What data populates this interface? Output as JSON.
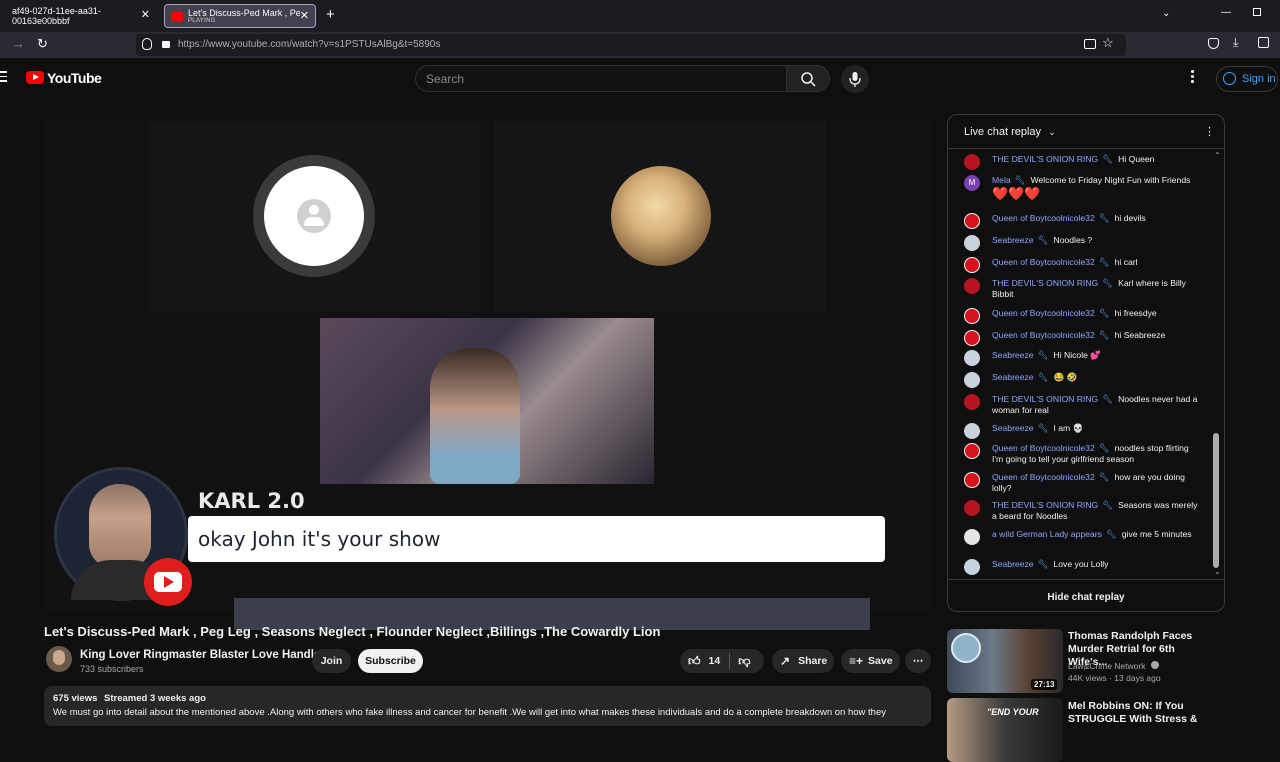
{
  "browser": {
    "tabs": [
      {
        "title": "af49-027d-11ee-aa31-00163e00bbbf"
      },
      {
        "title": "Let's Discuss-Ped Mark , Peg Le",
        "status": "PLAYING"
      }
    ],
    "url": "https://www.youtube.com/watch?v=s1PSTUsAlBg&t=5890s"
  },
  "header": {
    "logo": "YouTube",
    "search_placeholder": "Search",
    "signin": "Sign in"
  },
  "player": {
    "caption_name": "KARL 2.0",
    "caption_text": "okay John it's your show"
  },
  "video": {
    "title": "Let's Discuss-Ped Mark , Peg Leg , Seasons Neglect , Flounder Neglect ,Billings ,The Cowardly Lion",
    "channel": "King Lover Ringmaster Blaster Love Handle",
    "subscribers": "733 subscribers",
    "join": "Join",
    "subscribe": "Subscribe",
    "likes": "14",
    "share": "Share",
    "save": "Save",
    "views": "675 views",
    "streamed": "Streamed 3 weeks ago",
    "description": "We must go into detail about the mentioned above .Along with others who fake illness and cancer for benefit .We will get into what makes these individuals and do a complete breakdown on how they"
  },
  "chat": {
    "header": "Live chat replay",
    "footer": "Hide chat replay",
    "messages": [
      {
        "author": "THE DEVIL'S ONION RING",
        "text": "Hi Queen",
        "avatar": "devil"
      },
      {
        "author": "Mela",
        "text": "Welcome to Friday Night Fun with Friends",
        "extra": "❤️❤️❤️",
        "avatar": "m"
      },
      {
        "author": "Queen of Boytcoolnicole32",
        "text": "hi devils",
        "avatar": "stop"
      },
      {
        "author": "Seabreeze",
        "text": "Noodles ?",
        "avatar": "plain"
      },
      {
        "author": "Queen of Boytcoolnicole32",
        "text": "hi carl",
        "avatar": "stop"
      },
      {
        "author": "THE DEVIL'S ONION RING",
        "text": "Karl where is Billy Bibbit",
        "avatar": "devil"
      },
      {
        "author": "Queen of Boytcoolnicole32",
        "text": "hi freesdye",
        "avatar": "stop"
      },
      {
        "author": "Queen of Boytcoolnicole32",
        "text": "hi Seabreeze",
        "avatar": "stop"
      },
      {
        "author": "Seabreeze",
        "text": "Hi Nicole 💕",
        "avatar": "plain"
      },
      {
        "author": "Seabreeze",
        "text": "😂 🤣",
        "avatar": "plain"
      },
      {
        "author": "THE DEVIL'S ONION RING",
        "text": "Noodles never had a woman for real",
        "avatar": "devil"
      },
      {
        "author": "Seabreeze",
        "text": "I am 💀",
        "avatar": "plain"
      },
      {
        "author": "Queen of Boytcoolnicole32",
        "text": "noodles stop flirting I'm going to tell your girlfriend season",
        "avatar": "stop"
      },
      {
        "author": "Queen of Boytcoolnicole32",
        "text": "how are you doing lolly?",
        "avatar": "stop"
      },
      {
        "author": "THE DEVIL'S ONION RING",
        "text": "Seasons was merely a beard for Noodles",
        "avatar": "devil"
      },
      {
        "author": "a wild German Lady appears",
        "text": "give me 5 minutes",
        "avatar": "lady"
      },
      {
        "author": "Seabreeze",
        "text": "Love you Lolly",
        "avatar": "plain"
      }
    ]
  },
  "recommendations": [
    {
      "title": "Thomas Randolph Faces Murder Retrial for 6th Wife's...",
      "channel": "Law&Crime Network",
      "meta": "44K views · 13 days ago",
      "duration": "27:13"
    },
    {
      "title": "Mel Robbins ON: If You STRUGGLE With Stress &",
      "thumb_text": "\"END YOUR"
    }
  ],
  "colors": {
    "accent": "#ff0000",
    "link": "#3ea6ff",
    "author": "#8fa7ff"
  }
}
